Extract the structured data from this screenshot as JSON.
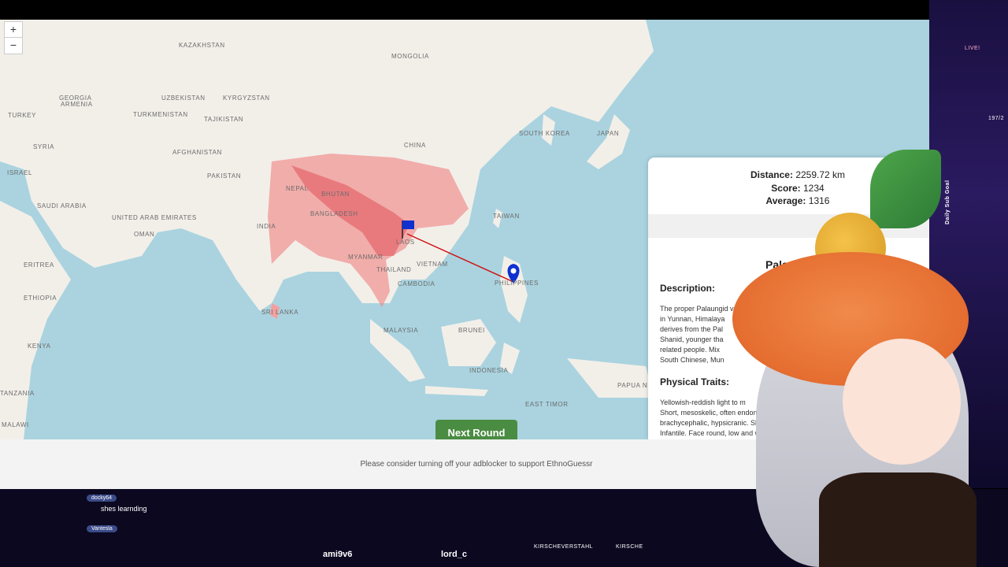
{
  "map": {
    "zoom_in": "+",
    "zoom_out": "−",
    "labels": [
      {
        "text": "KAZAKHSTAN"
      },
      {
        "text": "MONGOLIA"
      },
      {
        "text": "GEORGIA"
      },
      {
        "text": "ARMENIA"
      },
      {
        "text": "UZBEKISTAN"
      },
      {
        "text": "KYRGYZSTAN"
      },
      {
        "text": "TURKEY"
      },
      {
        "text": "TURKMENISTAN"
      },
      {
        "text": "TAJIKISTAN"
      },
      {
        "text": "CHINA"
      },
      {
        "text": "SOUTH KOREA"
      },
      {
        "text": "JAPAN"
      },
      {
        "text": "SYRIA"
      },
      {
        "text": "AFGHANISTAN"
      },
      {
        "text": "ISRAEL"
      },
      {
        "text": "PAKISTAN"
      },
      {
        "text": "SAUDI ARABIA"
      },
      {
        "text": "NEPAL"
      },
      {
        "text": "BHUTAN"
      },
      {
        "text": "UNITED ARAB EMIRATES"
      },
      {
        "text": "OMAN"
      },
      {
        "text": "BANGLADESH"
      },
      {
        "text": "INDIA"
      },
      {
        "text": "TAIWAN"
      },
      {
        "text": "MYANMAR"
      },
      {
        "text": "LAOS"
      },
      {
        "text": "VIETNAM"
      },
      {
        "text": "ERITREA"
      },
      {
        "text": "THAILAND"
      },
      {
        "text": "CAMBODIA"
      },
      {
        "text": "PHILIPPINES"
      },
      {
        "text": "ETHIOPIA"
      },
      {
        "text": "SRI LANKA"
      },
      {
        "text": "MALAYSIA"
      },
      {
        "text": "BRUNEI"
      },
      {
        "text": "KENYA"
      },
      {
        "text": "INDONESIA"
      },
      {
        "text": "TANZANIA"
      },
      {
        "text": "PAPUA NEW GUINEA"
      },
      {
        "text": "EAST TIMOR"
      },
      {
        "text": "MALAWI"
      }
    ]
  },
  "results": {
    "distance_label": "Distance:",
    "distance_value": "2259.72 km",
    "score_label": "Score:",
    "score_value": "1234",
    "average_label": "Average:",
    "average_value": "1316",
    "title": "Palau",
    "description_heading": "Description:",
    "description_lines": [
      "The proper Palaungid va",
      "in Yunnan, Himalaya",
      "derives from the Pal",
      "Shanid, younger tha",
      "related people. Mix",
      "South Chinese, Mun"
    ],
    "traits_heading": "Physical Traits:",
    "traits_lines": [
      "Yellowish-reddish light to m",
      "Short, mesoskelic, often endomo",
      "brachycephalic, hypsicranic. Short, ofte",
      "Infantile. Face round, low and wide with bul"
    ]
  },
  "next_round_label": "Next Round",
  "ad_notice": "Please consider turning off your adblocker to support EthnoGuessr",
  "stream": {
    "chat": [
      {
        "user": "docky64",
        "message": "shes learnding"
      },
      {
        "user": "Vantesla",
        "message": ""
      }
    ],
    "tickers": [
      "ami9v6",
      "lord_c"
    ],
    "socials": [
      "KIRSCHEVERSTAHL",
      "KIRSCHE"
    ],
    "side_labels": [
      "LIVE!",
      "197/2",
      "Daily Sub Goal"
    ]
  },
  "colors": {
    "ocean": "#aad3df",
    "land": "#f2efe9",
    "highlight": "#f08080",
    "button": "#4a8c42",
    "guess_line": "#d01010",
    "marker": "#1030d0"
  }
}
